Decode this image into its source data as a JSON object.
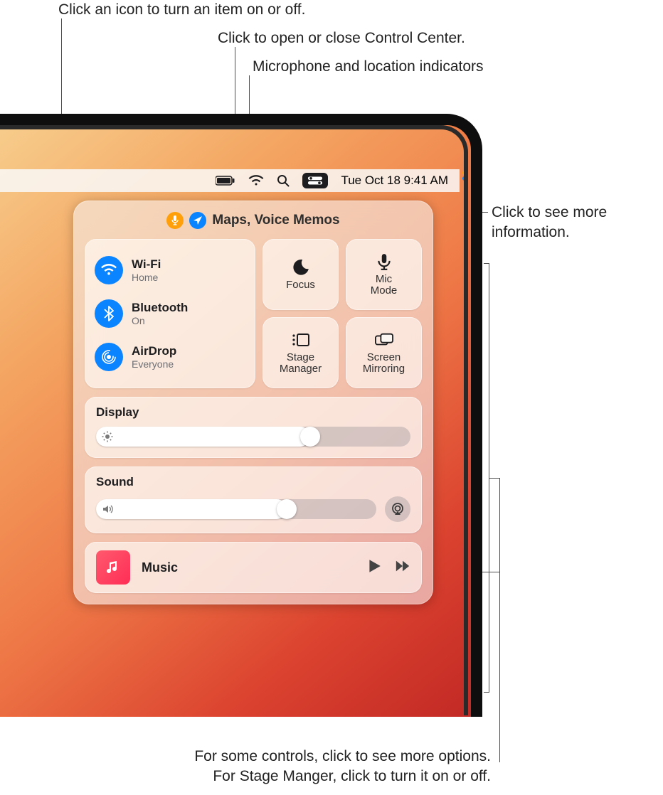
{
  "callouts": {
    "toggle": "Click an icon to turn an item on or off.",
    "open_cc": "Click to open or close Control Center.",
    "indicators": "Microphone and location indicators",
    "more_info_l1": "Click to see more",
    "more_info_l2": "information.",
    "bottom_l1": "For some controls, click to see more options.",
    "bottom_l2": "For Stage Manger, click to turn it on or off."
  },
  "menubar": {
    "datetime": "Tue Oct 18  9:41 AM"
  },
  "privacy": {
    "apps": "Maps, Voice Memos"
  },
  "connectivity": {
    "wifi": {
      "title": "Wi-Fi",
      "sub": "Home"
    },
    "bt": {
      "title": "Bluetooth",
      "sub": "On"
    },
    "airdrop": {
      "title": "AirDrop",
      "sub": "Everyone"
    }
  },
  "tiles": {
    "focus": "Focus",
    "micmode_l1": "Mic",
    "micmode_l2": "Mode",
    "stage_l1": "Stage",
    "stage_l2": "Manager",
    "mirror_l1": "Screen",
    "mirror_l2": "Mirroring"
  },
  "display": {
    "title": "Display",
    "value_pct": 68
  },
  "sound": {
    "title": "Sound",
    "value_pct": 68
  },
  "nowplaying": {
    "app": "Music"
  }
}
